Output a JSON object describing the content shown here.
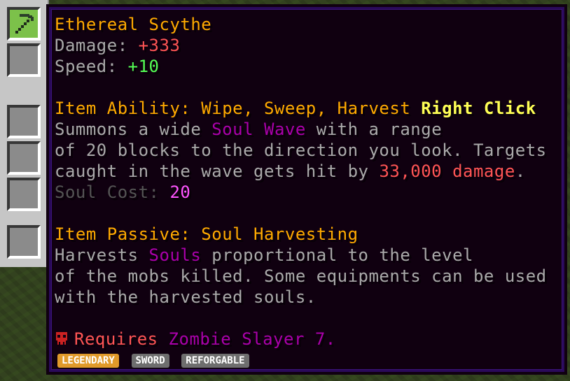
{
  "item": {
    "name": "Ethereal Scythe",
    "damage_label": "Damage: ",
    "damage_value": "+333",
    "speed_label": "Speed: ",
    "speed_value": "+10"
  },
  "ability": {
    "title": "Item Ability: Wipe, Sweep, Harvest ",
    "trigger": "Right Click",
    "line1_a": "Summons a wide ",
    "line1_b": "Soul Wave",
    "line1_c": " with a range",
    "line2": "of 20 blocks to the direction you look. Targets",
    "line3_a": "caught in the wave gets hit by ",
    "line3_b": "33,000 damage",
    "line3_c": ".",
    "cost_label": "Soul Cost: ",
    "cost_value": "20"
  },
  "passive": {
    "title": "Item Passive: Soul Harvesting",
    "line1_a": "Harvests ",
    "line1_b": "Souls",
    "line1_c": " proportional to the level",
    "line2": "of the mobs killed. Some equipments can be used",
    "line3": "with the harvested souls."
  },
  "requirement": {
    "label": "Requires ",
    "target": "Zombie Slayer 7."
  },
  "badges": [
    {
      "text": "LEGENDARY",
      "color": "#e09a2a"
    },
    {
      "text": "SWORD",
      "color": "#6e6e6e"
    },
    {
      "text": "REFORGABLE",
      "color": "#6e6e6e"
    }
  ],
  "colors": {
    "gold": "#ffaa00",
    "gray": "#aaaaaa",
    "red": "#ff5555",
    "green": "#55ff55",
    "purple": "#aa00aa",
    "pink": "#ff55ff",
    "yellow": "#ffff55"
  },
  "icons": {
    "slot_item": "scythe-icon",
    "requirement": "skull-icon"
  }
}
